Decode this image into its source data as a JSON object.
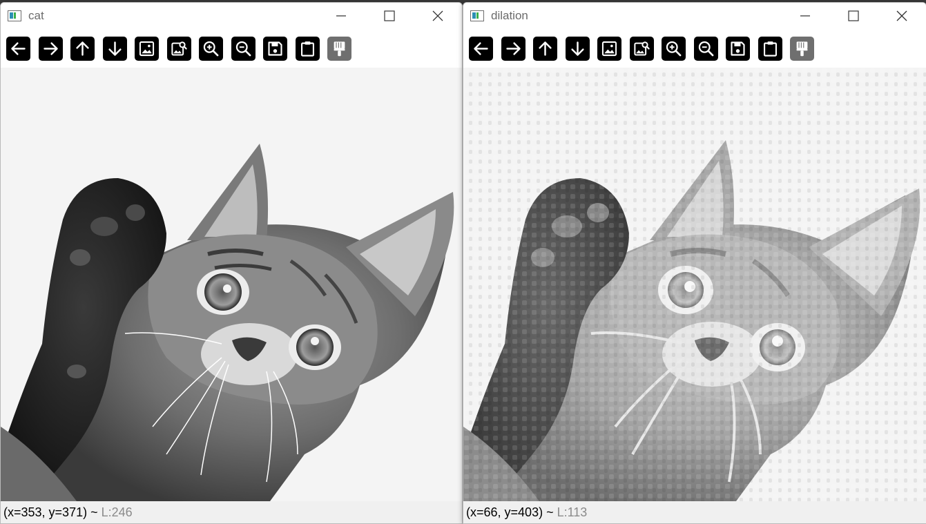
{
  "windows": [
    {
      "title": "cat",
      "status": {
        "coords": "(x=353, y=371)",
        "sep": " ~ ",
        "value": "L:246"
      }
    },
    {
      "title": "dilation",
      "status": {
        "coords": "(x=66, y=403)",
        "sep": " ~ ",
        "value": "L:113"
      }
    }
  ],
  "toolbar": [
    "arrow-left-icon",
    "arrow-right-icon",
    "arrow-up-icon",
    "arrow-down-icon",
    "image-icon",
    "zoom-image-icon",
    "zoom-in-icon",
    "zoom-out-icon",
    "save-icon",
    "clipboard-icon",
    "brush-icon"
  ],
  "caption_buttons": [
    "minimize-icon",
    "maximize-icon",
    "close-icon"
  ],
  "colors": {
    "toolbar_button": "#000000",
    "toolbar_button_disabled": "#6f6f6f",
    "canvas_bg": "#f4f4f4",
    "status_value": "#8a8a8a",
    "title_text": "#6b6b6b"
  }
}
